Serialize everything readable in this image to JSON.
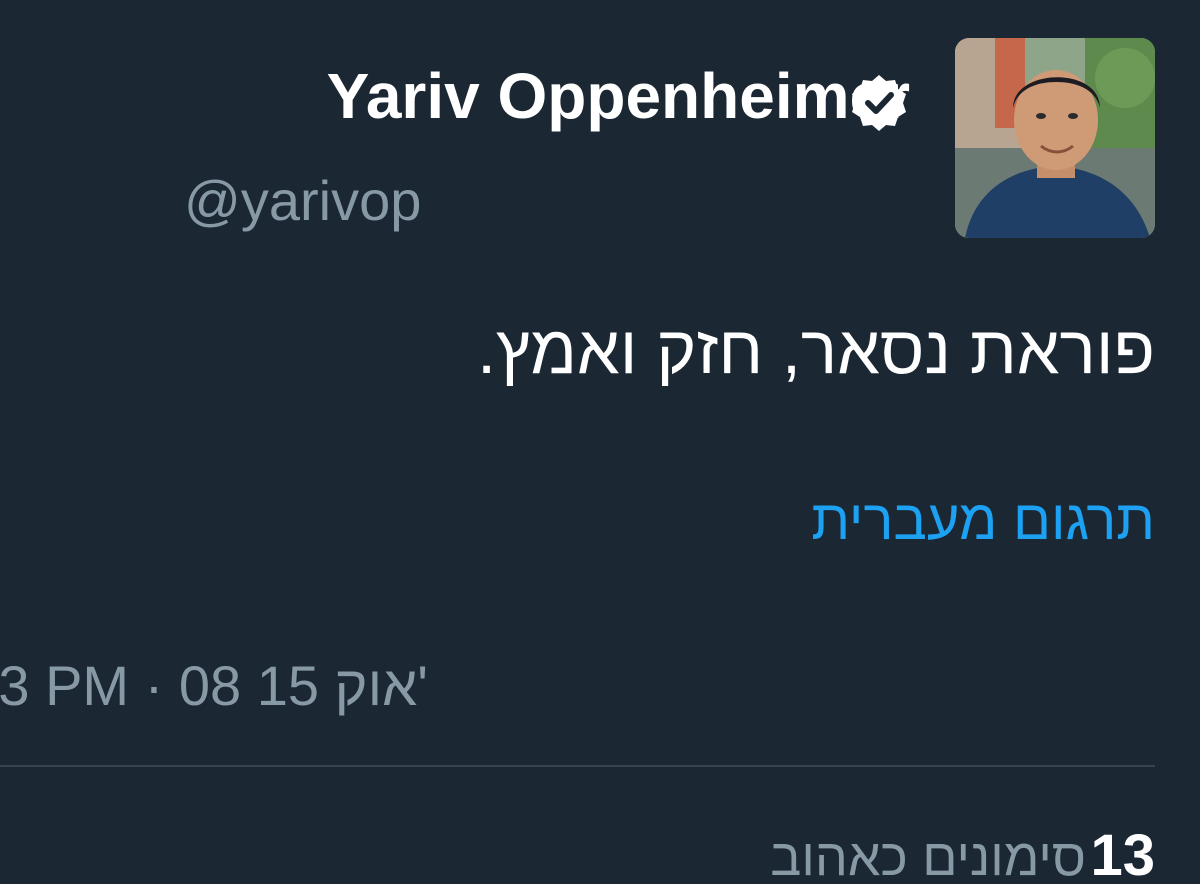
{
  "tweet": {
    "author_name": "Yariv Oppenheimer",
    "verified_icon": "verified-badge-icon",
    "handle": "@yarivop",
    "text": "פוראת נסאר, חזק ואמץ.",
    "translate_label": "תרגום מעברית",
    "timestamp": "3 PM · 08 15 אוק'",
    "likes_count": "13",
    "likes_label": "סימונים כאהוב"
  },
  "colors": {
    "background": "#1b2733",
    "text_primary": "#ffffff",
    "text_secondary": "#8899a6",
    "link": "#1da1f2",
    "divider": "#38444d"
  }
}
